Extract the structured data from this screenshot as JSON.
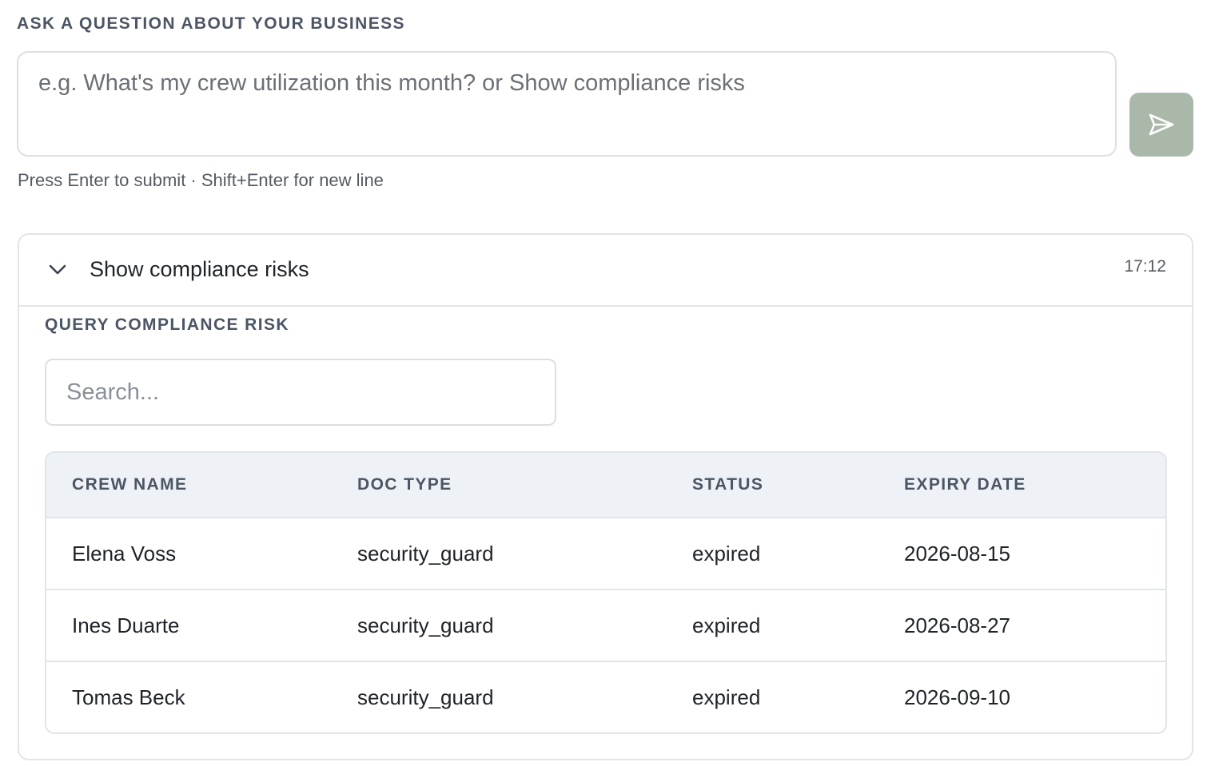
{
  "ask": {
    "label": "ASK A QUESTION ABOUT YOUR BUSINESS",
    "placeholder": "e.g. What's my crew utilization this month? or Show compliance risks",
    "value": "",
    "hint": "Press Enter to submit · Shift+Enter for new line",
    "send_icon": "send-icon",
    "send_color": "#a9b8a9"
  },
  "result": {
    "title": "Show compliance risks",
    "timestamp": "17:12",
    "expand_icon": "chevron-down-icon",
    "section_label": "QUERY COMPLIANCE RISK",
    "search_placeholder": "Search...",
    "columns": [
      "CREW NAME",
      "DOC TYPE",
      "STATUS",
      "EXPIRY DATE"
    ],
    "rows": [
      [
        "Elena Voss",
        "security_guard",
        "expired",
        "2026-08-15"
      ],
      [
        "Ines Duarte",
        "security_guard",
        "expired",
        "2026-08-27"
      ],
      [
        "Tomas Beck",
        "security_guard",
        "expired",
        "2026-09-10"
      ]
    ]
  }
}
